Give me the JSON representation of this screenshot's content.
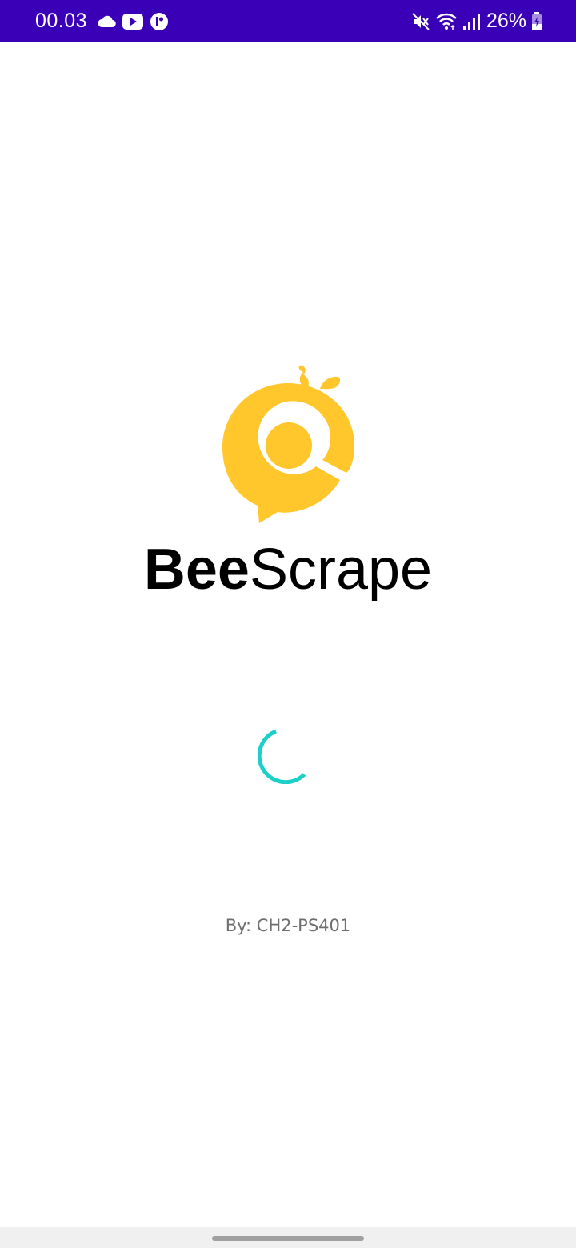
{
  "status_bar": {
    "time": "00.03",
    "battery": "26%",
    "icons": [
      "cloud-icon",
      "youtube-icon",
      "app-notification-icon",
      "mute-icon",
      "wifi-icon",
      "signal-icon",
      "battery-charging-icon"
    ],
    "background_color": "#3a00b7"
  },
  "app": {
    "name_bold": "Bee",
    "name_regular": "Scrape",
    "logo_color": "#ffc72c"
  },
  "loading": {
    "spinner_color": "#1ccfc9"
  },
  "credit": "By: CH2-PS401"
}
